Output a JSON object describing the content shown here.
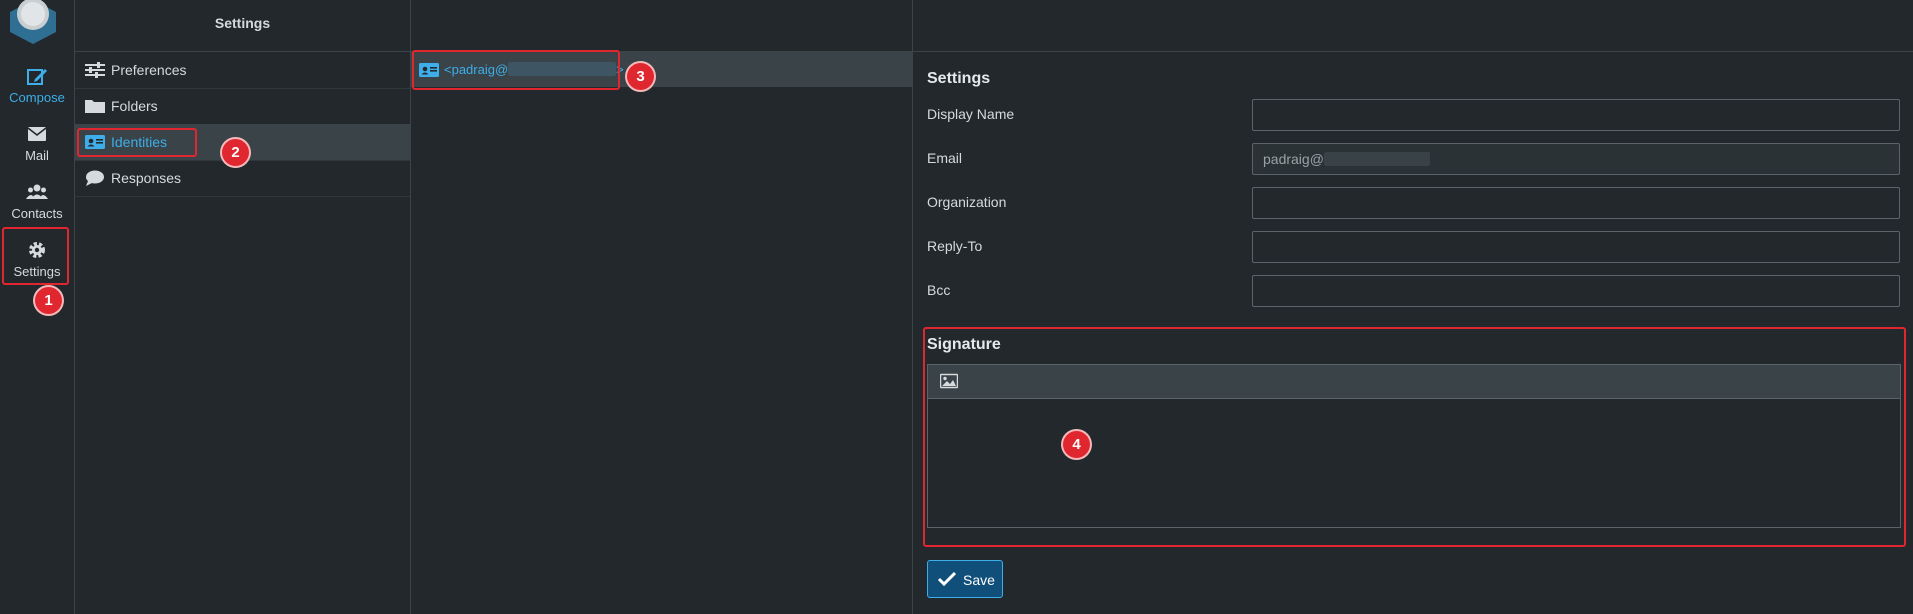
{
  "rail": {
    "items": [
      {
        "label": "Compose",
        "icon": "compose-icon"
      },
      {
        "label": "Mail",
        "icon": "mail-icon"
      },
      {
        "label": "Contacts",
        "icon": "contacts-icon"
      },
      {
        "label": "Settings",
        "icon": "gear-icon"
      }
    ]
  },
  "settings_panel": {
    "title": "Settings",
    "items": [
      {
        "label": "Preferences",
        "icon": "sliders-icon"
      },
      {
        "label": "Folders",
        "icon": "folder-icon"
      },
      {
        "label": "Identities",
        "icon": "id-card-icon"
      },
      {
        "label": "Responses",
        "icon": "speech-bubble-icon"
      }
    ]
  },
  "identities": {
    "items": [
      {
        "prefix": "<padraig@",
        "suffix": ">"
      }
    ]
  },
  "form": {
    "section_title": "Settings",
    "fields": [
      {
        "label": "Display Name",
        "value": ""
      },
      {
        "label": "Email",
        "value": "padraig@"
      },
      {
        "label": "Organization",
        "value": ""
      },
      {
        "label": "Reply-To",
        "value": ""
      },
      {
        "label": "Bcc",
        "value": ""
      }
    ],
    "signature_title": "Signature",
    "save_label": "Save"
  },
  "annotations": [
    "1",
    "2",
    "3",
    "4"
  ],
  "colors": {
    "background": "#22282c",
    "accent": "#3daee9",
    "selected_row": "#3a4347",
    "annotation": "#e0262e",
    "save_button": "#0f4f7a"
  }
}
